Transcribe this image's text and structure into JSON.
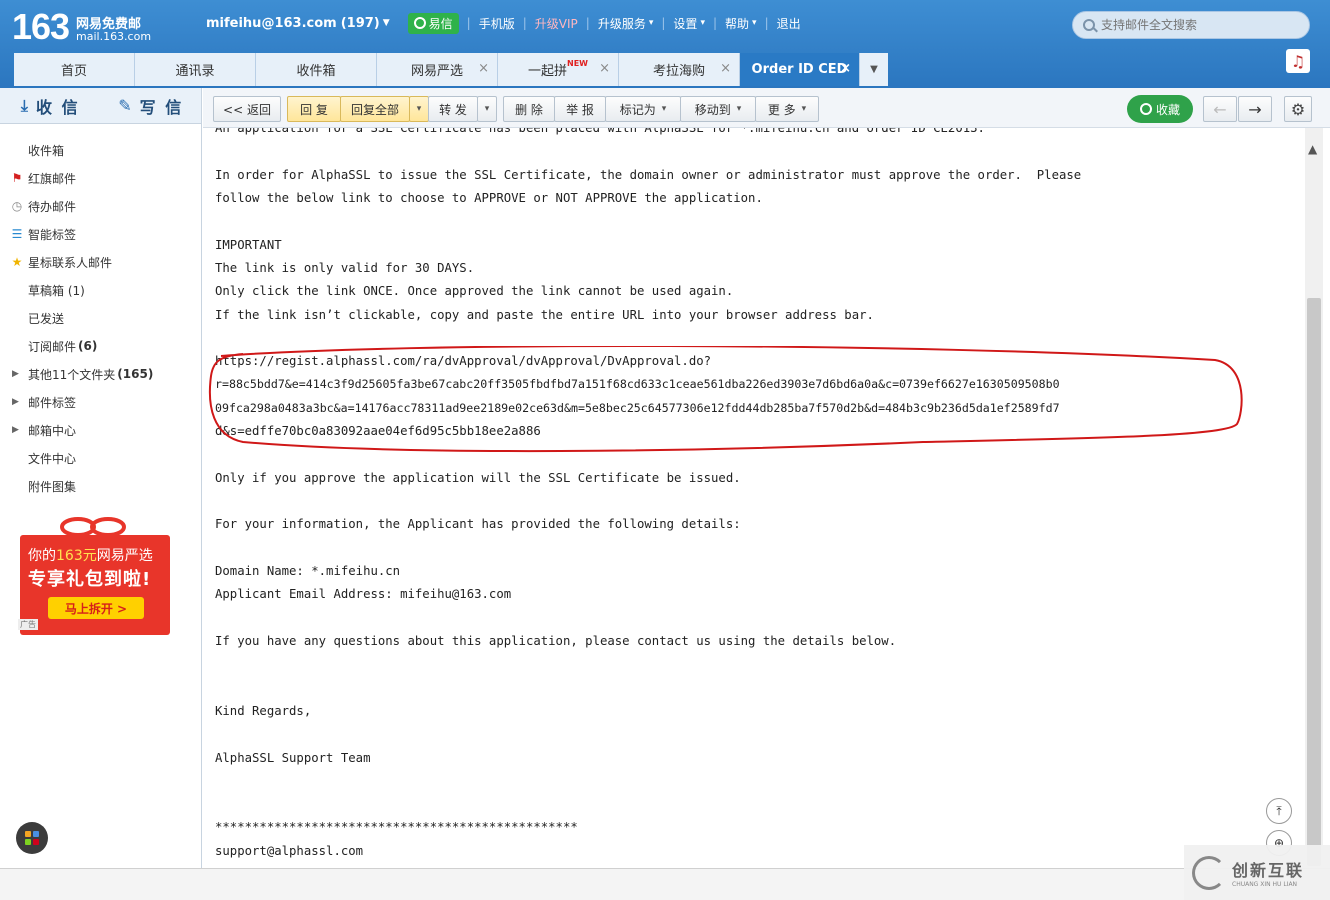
{
  "header": {
    "logo_number": "163",
    "logo_cn": "网易免费邮",
    "logo_domain": "mail.163.com",
    "account": "mifeihu@163.com",
    "unread": "(197)",
    "yixin": "易信",
    "links": [
      "手机版",
      "升级VIP",
      "升级服务",
      "设置",
      "帮助",
      "退出"
    ],
    "search_placeholder": "支持邮件全文搜索"
  },
  "tabs": [
    {
      "label": "首页"
    },
    {
      "label": "通讯录"
    },
    {
      "label": "收件箱"
    },
    {
      "label": "网易严选"
    },
    {
      "label": "一起拼",
      "badge": "NEW"
    },
    {
      "label": "考拉海购"
    },
    {
      "label": "Order ID CED"
    }
  ],
  "sidebar": {
    "receive": "收 信",
    "compose": "写 信",
    "folders": [
      {
        "label": "收件箱"
      },
      {
        "label": "红旗邮件",
        "icon": "red-flag-icon"
      },
      {
        "label": "待办邮件",
        "icon": "clock-icon"
      },
      {
        "label": "智能标签",
        "icon": "tag-bars-icon"
      },
      {
        "label": "星标联系人邮件",
        "icon": "star-icon"
      },
      {
        "label": "草稿箱 (1)"
      },
      {
        "label": "已发送"
      },
      {
        "label": "订阅邮件",
        "count": "(6)"
      },
      {
        "label": "其他11个文件夹",
        "count": "(165)",
        "expandable": true
      },
      {
        "label": "邮件标签",
        "expandable": true
      },
      {
        "label": "邮箱中心",
        "expandable": true
      },
      {
        "label": "文件中心"
      },
      {
        "label": "附件图集"
      }
    ],
    "promo": {
      "line1_a": "你的",
      "line1_b": "163元",
      "line1_c": "网易严选",
      "line2": "专享礼包到啦!",
      "cta": "马上拆开 >",
      "ad": "广告"
    }
  },
  "toolbar": {
    "back": "<< 返回",
    "reply": "回 复",
    "reply_all": "回复全部",
    "forward": "转 发",
    "delete": "删 除",
    "report": "举 报",
    "mark_as": "标记为",
    "move_to": "移动到",
    "more": "更 多",
    "favorite": "收藏"
  },
  "email": {
    "line_top": "An application for a SSL Certificate has been placed with AlphaSSL for *.mifeihu.cn and order ID CE2013.",
    "p1a": "In order for AlphaSSL to issue the SSL Certificate, the domain owner or administrator must approve the order.  Please",
    "p1b": "follow the below link to choose to APPROVE or NOT APPROVE the application.",
    "important": "IMPORTANT",
    "imp1": "The link is only valid for 30 DAYS.",
    "imp2": "Only click the link ONCE. Once approved the link cannot be used again.",
    "imp3": "If the link isn’t clickable, copy and paste the entire URL into your browser address bar.",
    "url1": "https://regist.alphassl.com/ra/dvApproval/dvApproval/DvApproval.do?",
    "url2": "r=88c5bdd7&e=414c3f9d25605fa3be67cabc20ff3505fbdfbd7a151f68cd633c1ceae561dba226ed3903e7d6bd6a0a&c=0739ef6627e1630509508b0",
    "url3": "09fca298a0483a3bc&a=14176acc78311ad9ee2189e02ce63d&m=5e8bec25c64577306e12fdd44db285ba7f570d2b&d=484b3c9b236d5da1ef2589fd7",
    "url4": "d&s=edffe70bc0a83092aae04ef6d95c5bb18ee2a886",
    "issued": "Only if you approve the application will the SSL Certificate be issued.",
    "info": "For your information, the Applicant has provided the following details:",
    "domain": "Domain Name: *.mifeihu.cn",
    "applicant": "Applicant Email Address: mifeihu@163.com",
    "questions": "If you have any questions about this application, please contact us using the details below.",
    "regards": "Kind Regards,",
    "team": "AlphaSSL Support Team",
    "stars": "*************************************************",
    "support": "support@alphassl.com"
  },
  "watermark": {
    "cn": "创新互联",
    "en": "CHUANG XIN HU LIAN"
  },
  "colors": {
    "header_blue": "#2b76bf",
    "active_tab": "#2a7ac5",
    "green": "#2fa24a",
    "annotation_red": "#d01818"
  }
}
